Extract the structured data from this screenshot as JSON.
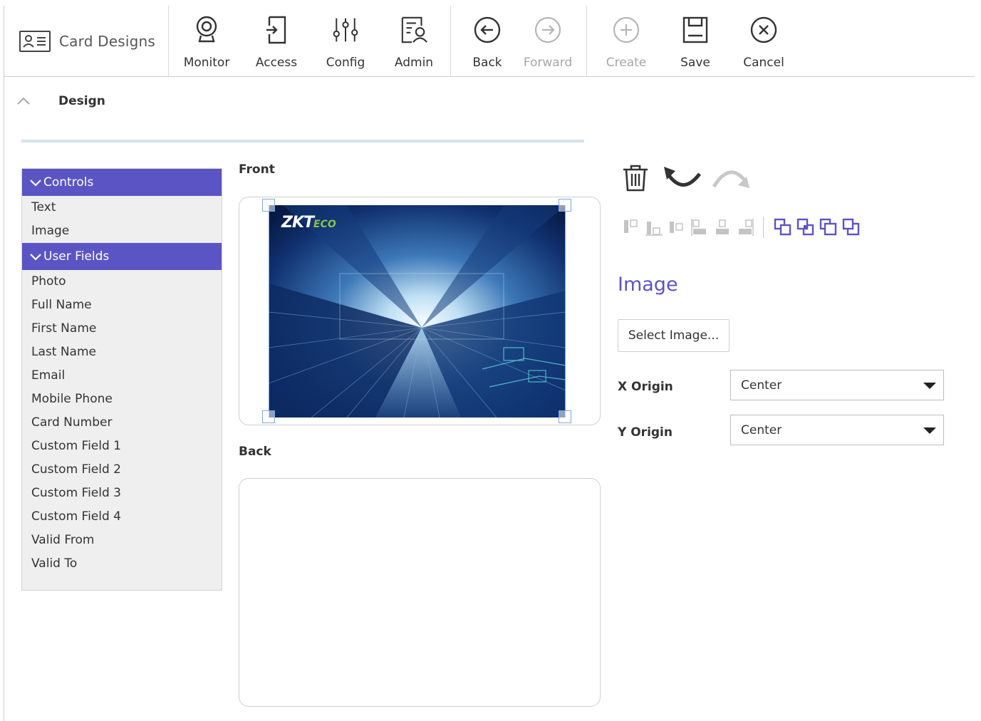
{
  "app": {
    "title": "Card Designs",
    "icon": "id-card-icon"
  },
  "toolbar": {
    "monitor": {
      "label": "Monitor",
      "icon": "webcam-icon"
    },
    "access": {
      "label": "Access",
      "icon": "door-icon"
    },
    "config": {
      "label": "Config",
      "icon": "sliders-icon"
    },
    "admin": {
      "label": "Admin",
      "icon": "admin-icon"
    },
    "back": {
      "label": "Back",
      "icon": "arrow-left-circle-icon"
    },
    "forward": {
      "label": "Forward",
      "icon": "arrow-right-circle-icon",
      "disabled": true
    },
    "create": {
      "label": "Create",
      "icon": "plus-circle-icon",
      "disabled": true
    },
    "save": {
      "label": "Save",
      "icon": "floppy-disk-icon"
    },
    "cancel": {
      "label": "Cancel",
      "icon": "x-circle-icon"
    }
  },
  "design": {
    "title": "Design",
    "expanded": true
  },
  "controls": {
    "header": "Controls",
    "items": [
      {
        "label": "Text"
      },
      {
        "label": "Image"
      }
    ]
  },
  "user_fields": {
    "header": "User Fields",
    "items": [
      {
        "label": "Photo"
      },
      {
        "label": "Full Name"
      },
      {
        "label": "First Name"
      },
      {
        "label": "Last Name"
      },
      {
        "label": "Email"
      },
      {
        "label": "Mobile Phone"
      },
      {
        "label": "Card Number"
      },
      {
        "label": "Custom Field 1"
      },
      {
        "label": "Custom Field 2"
      },
      {
        "label": "Custom Field 3"
      },
      {
        "label": "Custom Field 4"
      },
      {
        "label": "Valid From"
      },
      {
        "label": "Valid To"
      }
    ]
  },
  "card": {
    "front_label": "Front",
    "back_label": "Back",
    "brand_main": "ZKT",
    "brand_sub": "ECO"
  },
  "properties": {
    "title": "Image",
    "select_image_label": "Select Image...",
    "x_origin": {
      "label": "X Origin",
      "value": "Center"
    },
    "y_origin": {
      "label": "Y Origin",
      "value": "Center"
    }
  },
  "colors": {
    "accent": "#5b54c4",
    "panel_bg": "#efefef",
    "selection": "#7da7dd"
  }
}
